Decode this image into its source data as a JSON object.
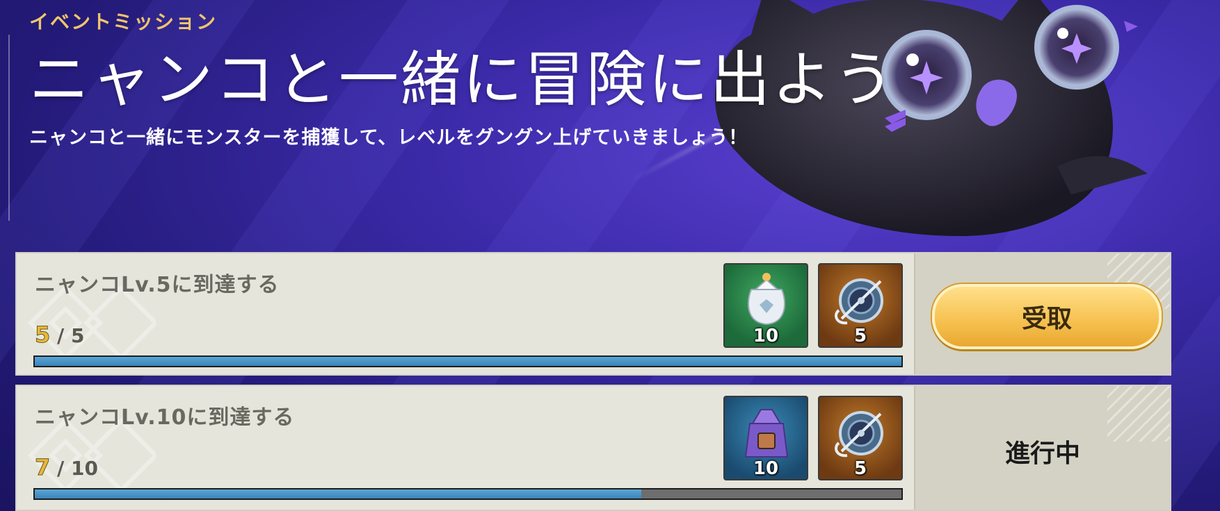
{
  "header": {
    "event_label": "イベントミッション",
    "title": "ニャンコと一緒に冒険に出よう",
    "subtitle": "ニャンコと一緒にモンスターを捕獲して、レベルをグングン上げていきましょう！"
  },
  "missions": [
    {
      "title": "ニャンコLv.5に到達する",
      "current": "5",
      "total": "/ 5",
      "progress": 1.0,
      "rewards": [
        {
          "icon": "white-gift-bag-icon",
          "qty": "10"
        },
        {
          "icon": "compass-orb-icon",
          "qty": "5"
        }
      ],
      "action_label": "受取",
      "action_type": "button"
    },
    {
      "title": "ニャンコLv.10に到達する",
      "current": "7",
      "total": "/ 10",
      "progress": 0.7,
      "rewards": [
        {
          "icon": "purple-pouch-icon",
          "qty": "10"
        },
        {
          "icon": "compass-orb-icon",
          "qty": "5"
        }
      ],
      "action_label": "進行中",
      "action_type": "status"
    }
  ],
  "colors": {
    "accent_gold": "#f1c56a",
    "progress_fill": "#4a94c8",
    "button_gold": "#f6c04e"
  }
}
